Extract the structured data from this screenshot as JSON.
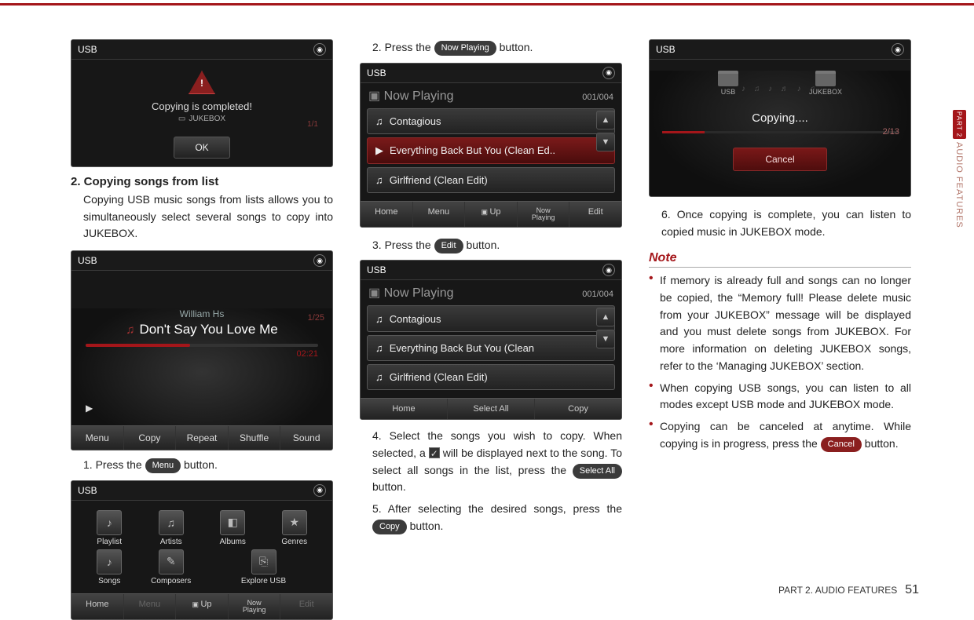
{
  "side_tab": {
    "part": "PART 2",
    "label": "AUDIO FEATURES"
  },
  "footer": {
    "text": "PART 2. AUDIO FEATURES",
    "page": "51"
  },
  "col1": {
    "shot1": {
      "title": "USB",
      "msg": "Copying is completed!",
      "sub": "JUKEBOX",
      "count": "1/1",
      "ok": "OK"
    },
    "heading": "2. Copying songs from list",
    "intro": "Copying USB music songs from lists allows you to simultaneously select several songs to copy into JUKEBOX.",
    "player": {
      "title": "USB",
      "count": "1/25",
      "artist": "William Hs",
      "song": "Don't Say You Love Me",
      "time": "02:21",
      "btns": [
        "Menu",
        "Copy",
        "Repeat",
        "Shuffle",
        "Sound"
      ]
    },
    "step1_a": "1. Press the ",
    "step1_btn": "Menu",
    "step1_b": " button.",
    "menu": {
      "title": "USB",
      "cells": [
        "Playlist",
        "Artists",
        "Albums",
        "Genres",
        "Songs",
        "Composers",
        "Explore USB"
      ],
      "bottom": [
        "Home",
        "Menu",
        "Up",
        "Now\nPlaying",
        "Edit"
      ]
    }
  },
  "col2": {
    "step2_a": "2. Press the ",
    "step2_btn": "Now Playing",
    "step2_b": " button.",
    "list1": {
      "title": "USB",
      "head": "Now Playing",
      "count": "001/004",
      "rows": [
        "Contagious",
        "Everything Back But You (Clean Ed..",
        "Girlfriend (Clean Edit)"
      ],
      "bottom": [
        "Home",
        "Menu",
        "Up",
        "Now\nPlaying",
        "Edit"
      ]
    },
    "step3_a": "3. Press the ",
    "step3_btn": "Edit",
    "step3_b": " button.",
    "list2": {
      "title": "USB",
      "head": "Now Playing",
      "count": "001/004",
      "rows": [
        "Contagious",
        "Everything Back But You (Clean",
        "Girlfriend (Clean Edit)"
      ],
      "bottom": [
        "Home",
        "Select All",
        "Copy"
      ]
    },
    "step4_a": "4. Select the songs you wish to copy. When selected, a ",
    "step4_b": " will be displayed next to the song. To select all songs in the list, press the ",
    "step4_btn": "Select All",
    "step4_c": " button.",
    "step5_a": "5. After selecting the desired songs, press the ",
    "step5_btn": "Copy",
    "step5_b": " button."
  },
  "col3": {
    "copying": {
      "title": "USB",
      "fld1": "USB",
      "fld2": "JUKEBOX",
      "text": "Copying....",
      "count": "2/13",
      "cancel": "Cancel"
    },
    "step6": "6. Once copying is complete, you can listen to copied music in JUKEBOX mode.",
    "note_h": "Note",
    "note1": "If memory is already full and songs can no longer be copied, the “Memory full! Please delete music from your JUKEBOX” message will be displayed and you must delete songs from JUKEBOX. For more information on deleting JUKEBOX songs, refer to the ‘Managing JUKEBOX’ section.",
    "note2": "When copying USB songs, you can listen to all modes except USB mode and JUKEBOX mode.",
    "note3_a": "Copying can be canceled at anytime. While copying is in progress, press the ",
    "note3_btn": "Cancel",
    "note3_b": " button."
  }
}
